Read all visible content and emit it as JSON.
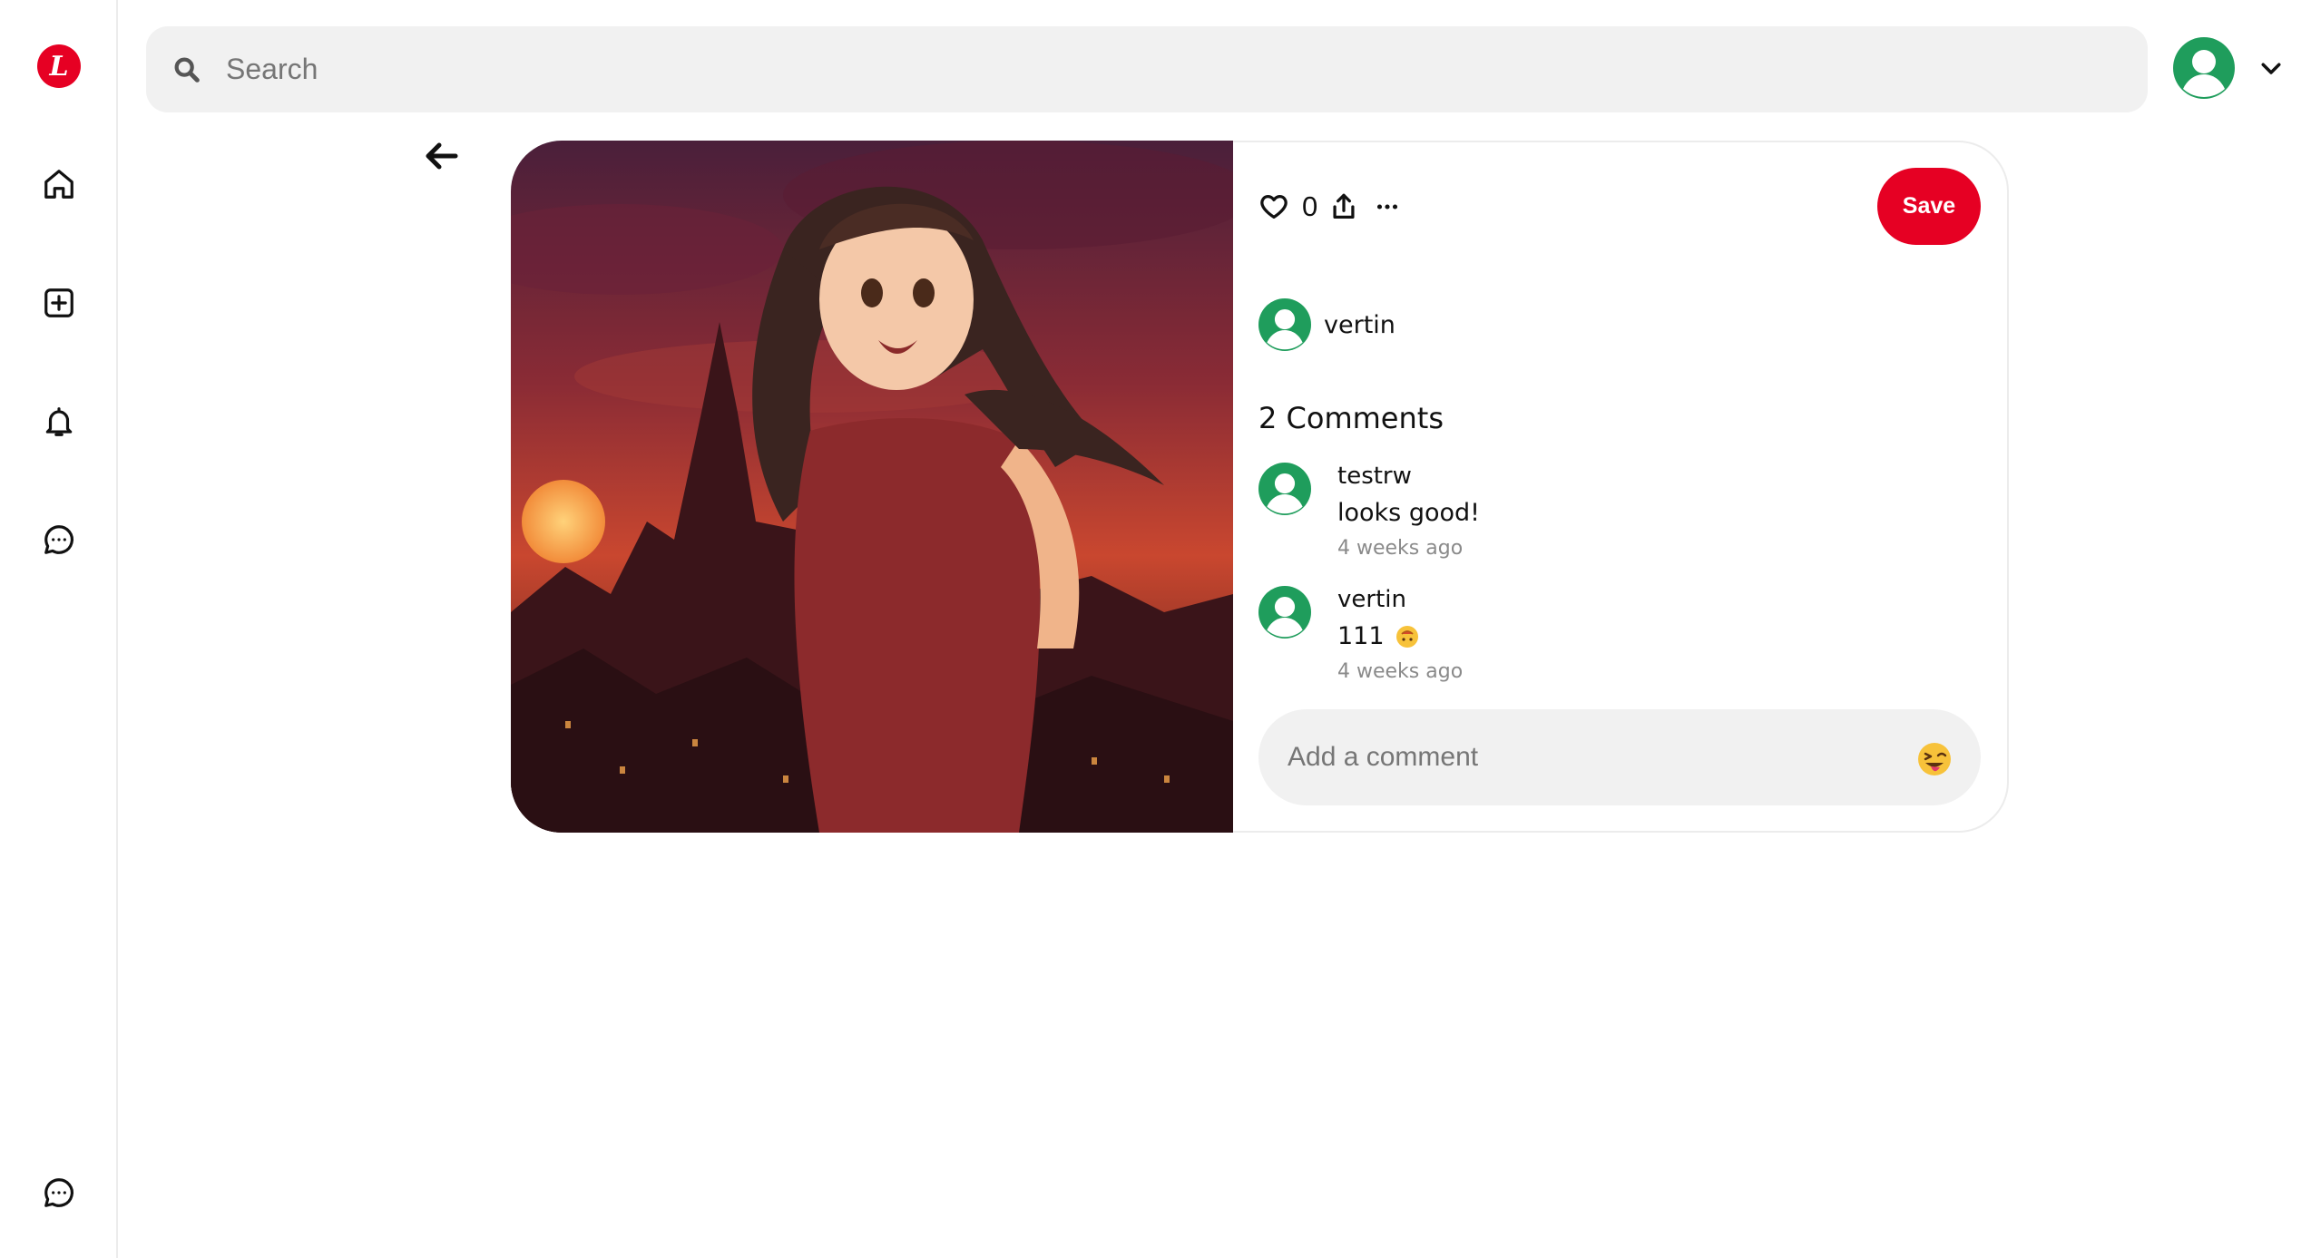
{
  "app": {
    "logo_letter": "L",
    "brand_color": "#e60023",
    "avatar_color": "#1f9d5c"
  },
  "sidebar": {
    "items": [
      {
        "name": "home",
        "icon": "home-icon"
      },
      {
        "name": "create",
        "icon": "plus-square-icon"
      },
      {
        "name": "notifications",
        "icon": "bell-icon"
      },
      {
        "name": "messages",
        "icon": "message-icon"
      },
      {
        "name": "help",
        "icon": "message-icon"
      }
    ]
  },
  "search": {
    "placeholder": "Search",
    "value": ""
  },
  "pin": {
    "likes": "0",
    "save_label": "Save",
    "author": "vertin",
    "comments_title": "2 Comments",
    "comments": [
      {
        "user": "testrw",
        "text": "looks good!",
        "time": "4 weeks ago"
      },
      {
        "user": "vertin",
        "text": "111",
        "emoji": "upside-down-face-emoji",
        "time": "4 weeks ago"
      }
    ],
    "comment_input": {
      "placeholder": "Add a comment",
      "value": ""
    }
  }
}
